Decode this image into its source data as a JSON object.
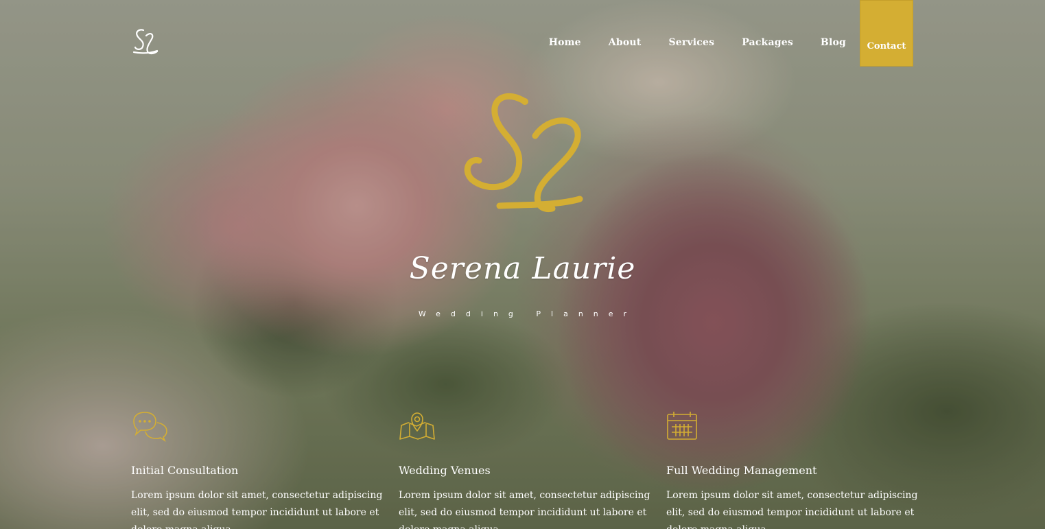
{
  "nav": {
    "items": [
      {
        "label": "Home"
      },
      {
        "label": "About"
      },
      {
        "label": "Services"
      },
      {
        "label": "Packages"
      },
      {
        "label": "Blog"
      }
    ],
    "contact_label": "Contact"
  },
  "logo": {
    "small_icon": "sl-monogram-icon",
    "large_icon": "sl-monogram-icon"
  },
  "hero": {
    "name": "Serena Laurie",
    "tagline": "Wedding Planner"
  },
  "features": [
    {
      "icon": "chat-bubbles-icon",
      "title": "Initial Consultation",
      "text": "Lorem ipsum dolor sit amet, consectetur adipiscing elit, sed do eiusmod tempor incididunt ut labore et dolore magna aliqua."
    },
    {
      "icon": "map-pin-icon",
      "title": "Wedding Venues",
      "text": "Lorem ipsum dolor sit amet, consectetur adipiscing elit, sed do eiusmod tempor incididunt ut labore et dolore magna aliqua."
    },
    {
      "icon": "calendar-icon",
      "title": "Full Wedding Management",
      "text": "Lorem ipsum dolor sit amet, consectetur adipiscing elit, sed do eiusmod tempor incididunt ut labore et dolore magna aliqua."
    }
  ],
  "colors": {
    "accent": "#d4ae33",
    "text": "#ffffff"
  }
}
